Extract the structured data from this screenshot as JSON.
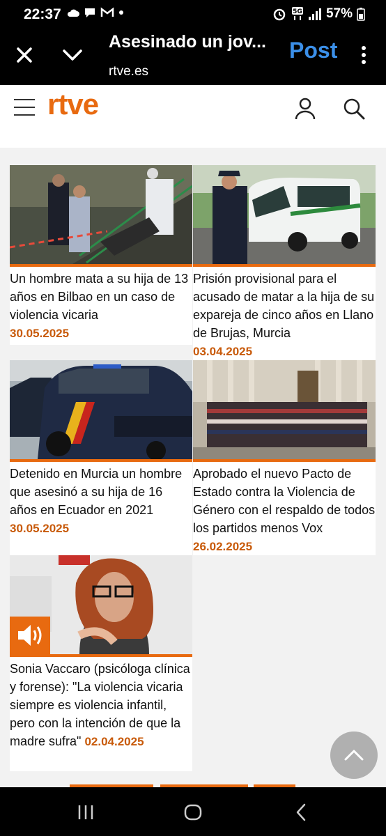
{
  "status_bar": {
    "time": "22:37",
    "battery": "57%",
    "network": "5G"
  },
  "tab_bar": {
    "title": "Asesinado un jov...",
    "url": "rtve.es",
    "post_label": "Post"
  },
  "site": {
    "logo": "rtve"
  },
  "articles": [
    {
      "title": "Un hombre mata a su hija de 13 años en Bilbao en un caso de violencia vicaria",
      "date": "30.05.2025"
    },
    {
      "title": "Prisión provisional para el acusado de matar a la hija de su expareja de cinco años en Llano de Brujas, Murcia",
      "date": "03.04.2025"
    },
    {
      "title": "Detenido en Murcia un hombre que asesinó a su hija de 16 años en Ecuador en 2021",
      "date": "30.05.2025"
    },
    {
      "title": "Aprobado el nuevo Pacto de Estado contra la Violencia de Género con el respaldo de todos los partidos menos Vox",
      "date": "26.02.2025"
    },
    {
      "title": "Sonia Vaccaro (psicóloga clínica y forense): \"La violencia vicaria siempre es violencia infantil, pero con la intención de que la madre sufra\"",
      "date": "02.04.2025"
    }
  ],
  "colors": {
    "accent": "#e86a10",
    "post": "#3b8fe8"
  },
  "icons": [
    "close-icon",
    "chevron-down-icon",
    "more-vert-icon",
    "hamburger-icon",
    "user-icon",
    "search-icon",
    "audio-icon",
    "arrow-up-icon"
  ]
}
